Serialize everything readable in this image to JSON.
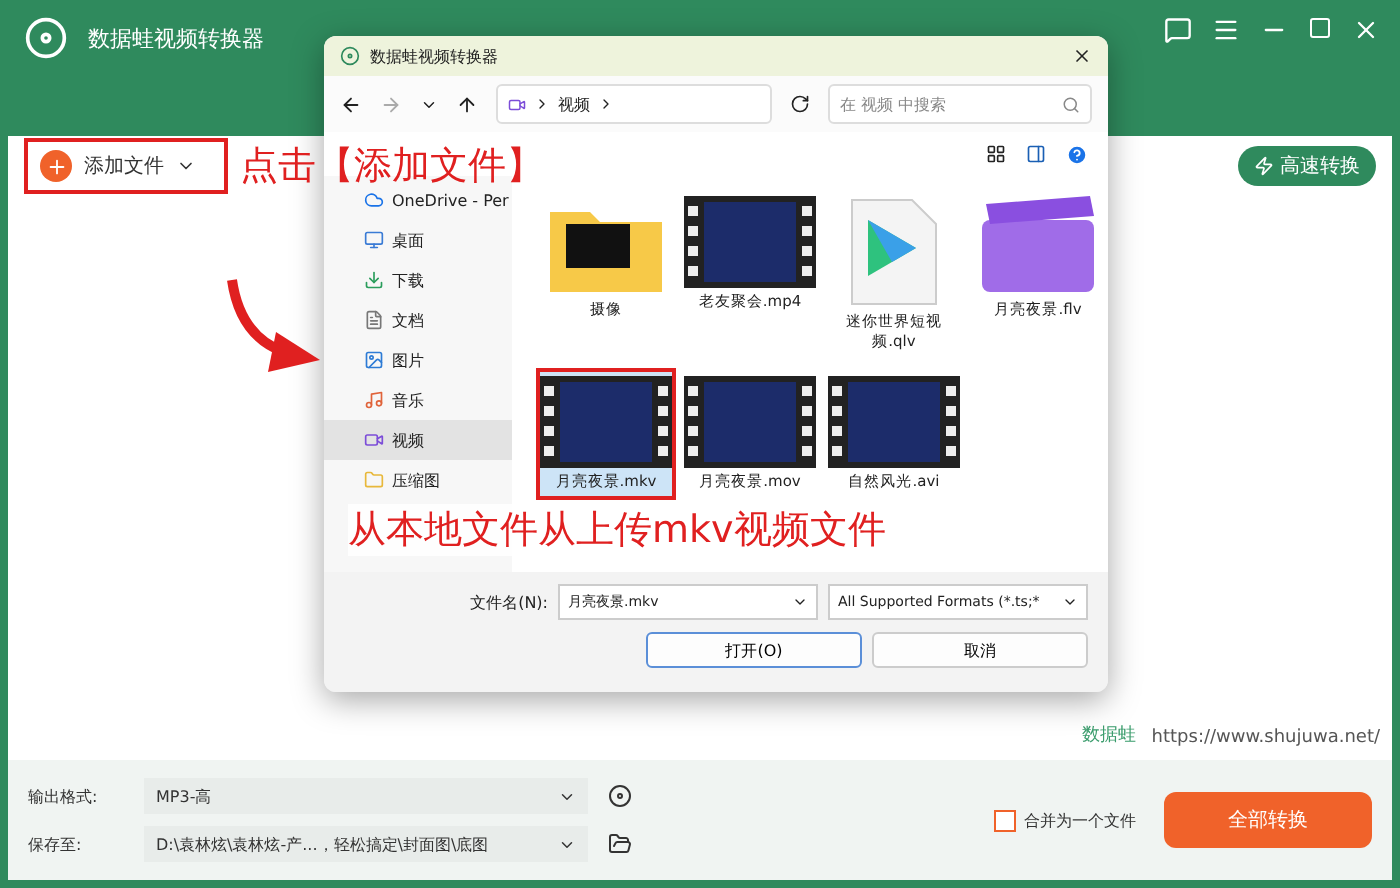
{
  "window": {
    "title": "数据蛙视频转换器"
  },
  "toolbar": {
    "add_button": "添加文件",
    "fast_button": "高速转换"
  },
  "brand": {
    "name": "数据蛙",
    "url": "https://www.shujuwa.net/"
  },
  "bottom": {
    "format_label": "输出格式:",
    "format_value": "MP3-高",
    "save_label": "保存至:",
    "save_value": "D:\\袁林炫\\袁林炫-产...，轻松搞定\\封面图\\底图",
    "merge_label": "合并为一个文件",
    "merge_checked": false,
    "convert_button": "全部转换"
  },
  "dialog": {
    "title": "数据蛙视频转换器",
    "path": "视频",
    "search_placeholder": "在 视频 中搜索",
    "sidebar": [
      {
        "label": "OneDrive - Per",
        "kind": "cloud",
        "selected": false
      },
      {
        "label": "桌面",
        "kind": "desktop",
        "selected": false
      },
      {
        "label": "下载",
        "kind": "download",
        "selected": false
      },
      {
        "label": "文档",
        "kind": "document",
        "selected": false
      },
      {
        "label": "图片",
        "kind": "picture",
        "selected": false
      },
      {
        "label": "音乐",
        "kind": "music",
        "selected": false
      },
      {
        "label": "视频",
        "kind": "video",
        "selected": true
      },
      {
        "label": "压缩图",
        "kind": "folder",
        "selected": false
      }
    ],
    "files": [
      {
        "name": "摄像",
        "kind": "folder",
        "selected": false
      },
      {
        "name": "老友聚会.mp4",
        "kind": "video",
        "selected": false
      },
      {
        "name": "迷你世界短视频.qlv",
        "kind": "qlv",
        "selected": false
      },
      {
        "name": "月亮夜景.flv",
        "kind": "clip",
        "selected": false
      },
      {
        "name": "月亮夜景.mkv",
        "kind": "video",
        "selected": true
      },
      {
        "name": "月亮夜景.mov",
        "kind": "video",
        "selected": false
      },
      {
        "name": "自然风光.avi",
        "kind": "video",
        "selected": false
      }
    ],
    "filename_label": "文件名(N):",
    "filename_value": "月亮夜景.mkv",
    "filetype": "All Supported Formats (*.ts;*",
    "open_button": "打开(O)",
    "cancel_button": "取消"
  },
  "annotations": [
    "点击【添加文件】",
    "从本地文件从上传mkv视频文件"
  ]
}
